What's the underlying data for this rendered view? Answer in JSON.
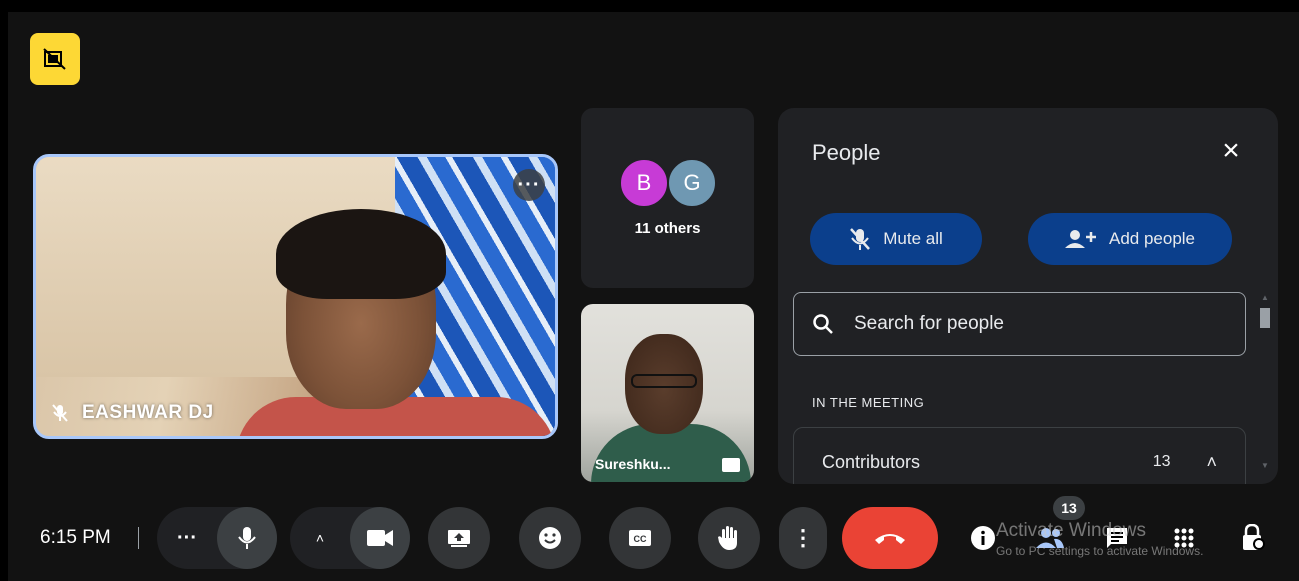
{
  "colors": {
    "accent_blue": "#a8c7fa",
    "pill_blue": "#0b3f8c",
    "end_call_red": "#ea4335",
    "avatar_b": "#c73bd6",
    "avatar_g": "#6f98b2",
    "camera_off_badge": "#fdd835"
  },
  "top_badge": {
    "icon": "camera-off-icon"
  },
  "main_tile": {
    "name": "EASHWAR DJ",
    "mic_icon": "mic-muted-small-icon",
    "more_icon": "more-horiz-icon"
  },
  "others_tile": {
    "avatars": [
      {
        "letter": "B",
        "color": "#c73bd6"
      },
      {
        "letter": "G",
        "color": "#6f98b2"
      }
    ],
    "label": "11 others"
  },
  "suresh_tile": {
    "name": "Sureshku...",
    "icon": "picture-in-picture-icon"
  },
  "people_panel": {
    "title": "People",
    "close_icon": "close-icon",
    "mute_all_label": "Mute all",
    "add_people_label": "Add people",
    "search_placeholder": "Search for people",
    "section_label": "IN THE MEETING",
    "contributors_label": "Contributors",
    "contributors_count": "13"
  },
  "controls": {
    "time": "6:15 PM",
    "people_badge": "13",
    "icons": [
      "more-horiz-icon",
      "mic-icon",
      "chevron-up-icon",
      "camera-icon",
      "present-icon",
      "emoji-icon",
      "captions-icon",
      "raise-hand-icon",
      "more-vert-icon",
      "end-call-icon",
      "info-icon",
      "people-icon",
      "chat-icon",
      "activities-icon",
      "host-controls-icon"
    ]
  },
  "watermark": {
    "line1": "Activate Windows",
    "line2": "Go to PC settings to activate Windows."
  }
}
